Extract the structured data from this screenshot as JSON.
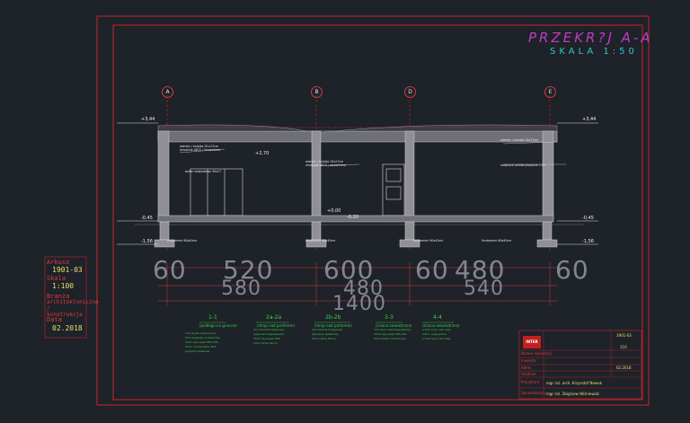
{
  "drawing": {
    "title": "PRZEKR?J A-A",
    "scale": "SKALA 1:50",
    "grid_labels": [
      "A",
      "B",
      "D",
      "E"
    ],
    "levels": [
      "+3,44",
      "+2,70",
      "+0,00",
      "-0,20",
      "-0,45",
      "-1,56",
      "+3,44",
      "-0,45",
      "-1,56"
    ],
    "bottom_dims_row1": [
      "60",
      "520",
      "600",
      "60",
      "480",
      "60"
    ],
    "bottom_dims_row2": [
      "580",
      "480",
      "540"
    ],
    "bottom_dims_total": "1400"
  },
  "sidebar": {
    "sheet_label": "Arkusz",
    "sheet_value": "1901-03",
    "scale_label": "Skala",
    "scale_value": "1:100",
    "branch_label": "Branża",
    "branch_value": "architektoniczna / konstrukcja",
    "date_label": "Data",
    "date_value": "02.2018"
  },
  "legend": {
    "columns": [
      {
        "head": "1-1",
        "sub": "(podłoga na gruncie)"
      },
      {
        "head": "2a-2a",
        "sub": "(strop nad parterem)"
      },
      {
        "head": "2b-2b",
        "sub": "(strop nad parterem)"
      },
      {
        "head": "3-3",
        "sub": "(ściana zewnętrzna)"
      },
      {
        "head": "4-4",
        "sub": "(ściana wewnętrzna)"
      }
    ]
  },
  "title_block": {
    "logo": "INTER",
    "rows": [
      "Nazwa inwestycji",
      "Inwestor",
      "Adres",
      "Stadium",
      "Projektant",
      "Sprawdzający"
    ],
    "sheet_no": "1901-03",
    "sheet_num": "110",
    "date": "02.2018",
    "designer": "mgr inż. arch. Krzysztof Nowak",
    "checker": "mgr inż. Zbigniew Wiśniewski"
  },
  "colors": {
    "background": "#1e2229",
    "frame": "#c8262c",
    "section_fill": "#8f8f95",
    "dimension_green": "#40c848",
    "title_magenta": "#c03cc4",
    "scale_cyan": "#33c6c8",
    "text_yellow": "#e6e06a"
  }
}
